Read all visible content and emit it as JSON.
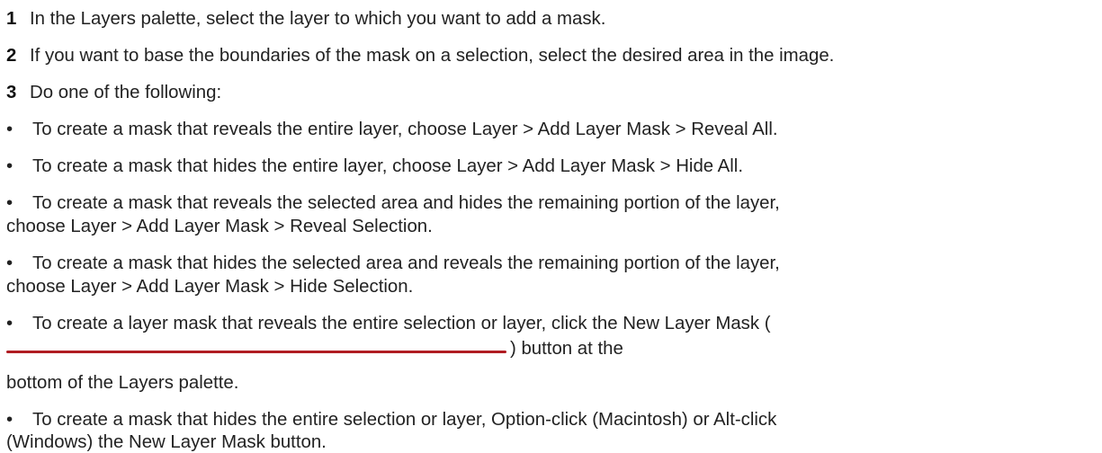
{
  "steps": [
    {
      "number": "1",
      "text": "In the Layers palette, select the layer to which you want to add a mask."
    },
    {
      "number": "2",
      "text": "If you want to base the boundaries of the mask on a selection, select the desired area in the image."
    },
    {
      "number": "3",
      "text": "Do one of the following:"
    }
  ],
  "bullet_symbol": "•",
  "bullets": [
    {
      "line1": "To create a mask that reveals the entire layer, choose Layer > Add Layer Mask > Reveal All."
    },
    {
      "line1": "To create a mask that hides the entire layer, choose Layer > Add Layer Mask > Hide All."
    },
    {
      "line1": "To create a mask that reveals the selected area and hides the remaining portion of the layer,",
      "line2": "choose Layer > Add Layer Mask > Reveal Selection."
    },
    {
      "line1": "To create a mask that hides the selected area and reveals the remaining portion of the layer,",
      "line2": "choose Layer > Add Layer Mask > Hide Selection."
    },
    {
      "line1": "To create a layer mask that reveals the entire selection or layer, click the New Layer Mask (",
      "line2": ") button at the",
      "line3": "bottom of the Layers palette."
    },
    {
      "line1": "To create a mask that hides the entire selection or layer, Option-click (Macintosh) or Alt-click",
      "line2": "(Windows) the New Layer Mask button."
    }
  ],
  "colors": {
    "icon_placeholder_line": "#b01c22",
    "text": "#222222"
  }
}
